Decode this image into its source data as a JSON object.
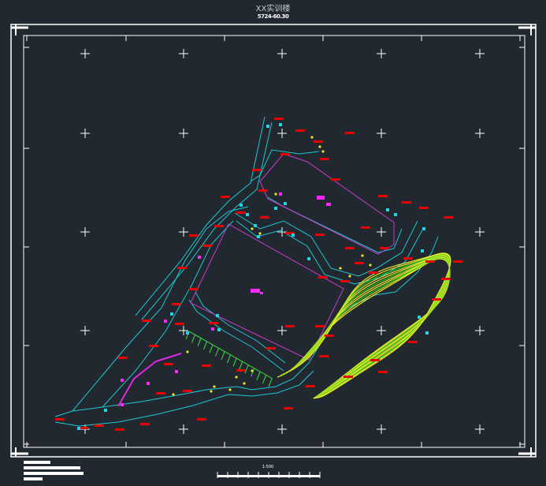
{
  "drawing": {
    "title": "XX实训楼",
    "subtitle": "5724-60.30",
    "scale": "1:500"
  },
  "colors": {
    "background": "#212830",
    "frame": "#ffffff",
    "road": "#1ec8d2",
    "building": "#c83cc8",
    "label": "#e60000",
    "contour_major": "#e6e628",
    "contour_minor": "#1ec81e",
    "marker": "#ff28ff",
    "point": "#28d2e6"
  }
}
